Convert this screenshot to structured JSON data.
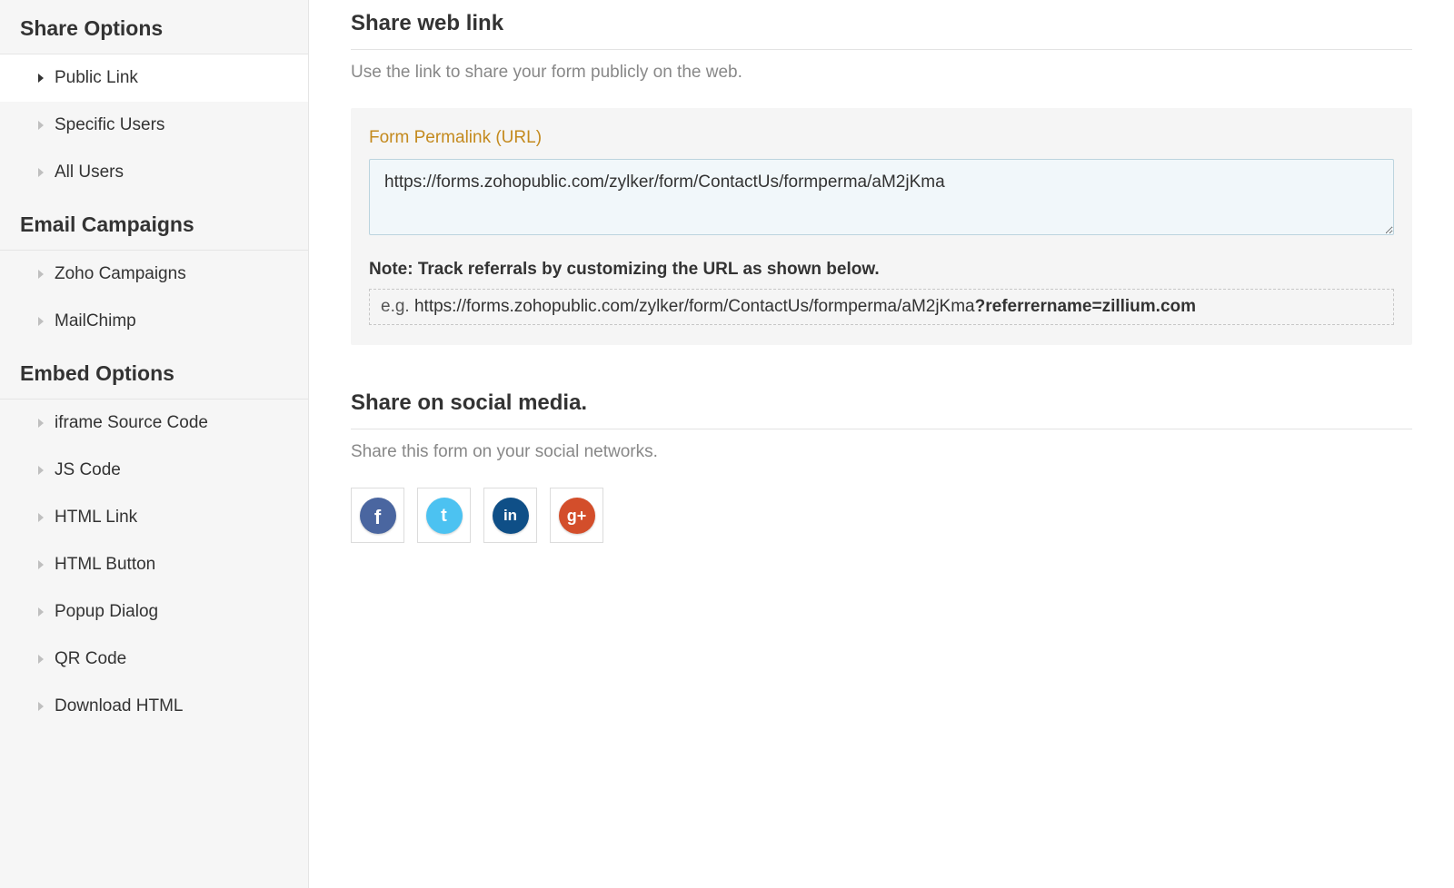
{
  "sidebar": {
    "sections": [
      {
        "title": "Share Options",
        "items": [
          {
            "label": "Public Link",
            "active": true
          },
          {
            "label": "Specific Users",
            "active": false
          },
          {
            "label": "All Users",
            "active": false
          }
        ]
      },
      {
        "title": "Email Campaigns",
        "items": [
          {
            "label": "Zoho Campaigns",
            "active": false
          },
          {
            "label": "MailChimp",
            "active": false
          }
        ]
      },
      {
        "title": "Embed Options",
        "items": [
          {
            "label": "iframe Source Code",
            "active": false
          },
          {
            "label": "JS Code",
            "active": false
          },
          {
            "label": "HTML Link",
            "active": false
          },
          {
            "label": "HTML Button",
            "active": false
          },
          {
            "label": "Popup Dialog",
            "active": false
          },
          {
            "label": "QR Code",
            "active": false
          },
          {
            "label": "Download HTML",
            "active": false
          }
        ]
      }
    ]
  },
  "main": {
    "title": "Share web link",
    "subtitle": "Use the link to share your form publicly on the web.",
    "permalink_label": "Form Permalink (URL)",
    "permalink_value": "https://forms.zohopublic.com/zylker/form/ContactUs/formperma/aM2jKma",
    "note_prefix": "Note:",
    "note_text": "Track referrals by customizing the URL as shown below.",
    "example_prefix": "e.g.",
    "example_url": "https://forms.zohopublic.com/zylker/form/ContactUs/formperma/aM2jKma",
    "example_query": "?referrername=zillium.com",
    "social_title": "Share on social media.",
    "social_subtitle": "Share this form on your social networks.",
    "social": {
      "facebook_glyph": "f",
      "twitter_glyph": "t",
      "linkedin_glyph": "in",
      "googleplus_glyph": "g+"
    }
  }
}
